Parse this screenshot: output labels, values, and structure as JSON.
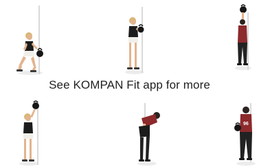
{
  "caption": "See KOMPAN  Fit app for more",
  "colors": {
    "background": "#ffffff",
    "caption_text": "#1f1f1f",
    "pole": "#d9d9d9",
    "skin": "#e2b48e",
    "hair_blonde": "#d8b676",
    "hair_dark": "#2b2420",
    "top_black": "#1c1c1c",
    "shorts_white": "#f1efe9",
    "weight_black": "#161616",
    "jersey_red": "#8c2a2c",
    "legs_dark": "#222222"
  },
  "icons": [
    "kettlebell-squat-figure",
    "kettlebell-hold-figure",
    "kettlebell-overhead-figure",
    "kettlebell-press-figure",
    "kettlebell-swing-figure",
    "kettlebell-carry-figure"
  ]
}
